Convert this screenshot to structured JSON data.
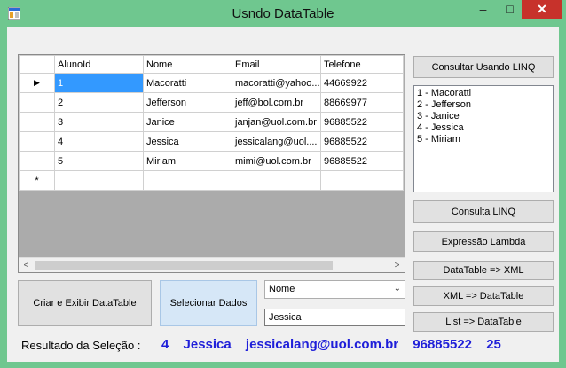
{
  "window": {
    "title": "Usndo DataTable",
    "minimize": "–",
    "maximize": "□",
    "close": "✕"
  },
  "grid": {
    "columns": [
      "AlunoId",
      "Nome",
      "Email",
      "Telefone"
    ],
    "rows": [
      [
        "1",
        "Macoratti",
        "macoratti@yahoo....",
        "44669922"
      ],
      [
        "2",
        "Jefferson",
        "jeff@bol.com.br",
        "88669977"
      ],
      [
        "3",
        "Janice",
        "janjan@uol.com.br",
        "96885522"
      ],
      [
        "4",
        "Jessica",
        "jessicalang@uol....",
        "96885522"
      ],
      [
        "5",
        "Miriam",
        "mimi@uol.com.br",
        "96885522"
      ]
    ],
    "current_row_marker": "▶",
    "new_row_marker": "*",
    "scroll_left": "<",
    "scroll_right": ">"
  },
  "buttons": {
    "consultar_linq": "Consultar Usando LINQ",
    "consulta_linq": "Consulta LINQ",
    "expressao_lambda": "Expressão Lambda",
    "datatable_xml": "DataTable => XML",
    "xml_datatable": "XML => DataTable",
    "list_datatable": "List => DataTable",
    "criar_exibir": "Criar e Exibir DataTable",
    "selecionar": "Selecionar Dados"
  },
  "listbox": [
    "1 - Macoratti",
    "2 - Jefferson",
    "3 - Janice",
    "4 - Jessica",
    "5 - Miriam"
  ],
  "filter": {
    "field_selected": "Nome",
    "value": "Jessica"
  },
  "result": {
    "label": "Resultado da Seleção :",
    "values": [
      "4",
      "Jessica",
      "jessicalang@uol.com.br",
      "96885522",
      "25"
    ]
  },
  "colors": {
    "titlebar": "#6fc78f",
    "close": "#c7322b",
    "selected_cell": "#3399ff",
    "result_text": "#1f1fd9"
  }
}
